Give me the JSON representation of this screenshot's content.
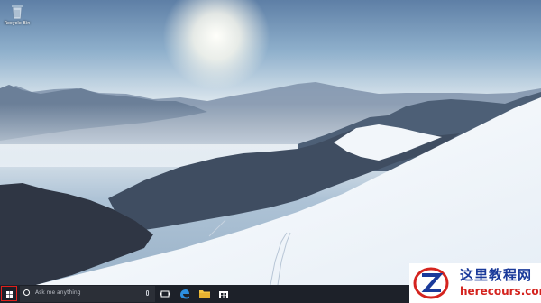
{
  "desktop": {
    "wallpaper": "snowy-mountain-landscape",
    "icons": [
      {
        "label": "Recycle Bin",
        "icon": "recycle-bin-icon"
      }
    ]
  },
  "taskbar": {
    "start_icon": "windows-logo-icon",
    "start_highlight_color": "#e0201c",
    "search": {
      "placeholder": "Ask me anything",
      "icon": "cortana-circle-icon",
      "mic_icon": "microphone-icon"
    },
    "pinned": [
      {
        "name": "task-view",
        "icon": "task-view-icon"
      },
      {
        "name": "edge",
        "icon": "edge-browser-icon"
      },
      {
        "name": "file-explorer",
        "icon": "folder-icon"
      },
      {
        "name": "store",
        "icon": "store-bag-icon"
      }
    ],
    "background_color": "#1d2129"
  },
  "watermark": {
    "title": "这里教程网",
    "url": "herecours.com",
    "logo": "z-logo-icon"
  }
}
